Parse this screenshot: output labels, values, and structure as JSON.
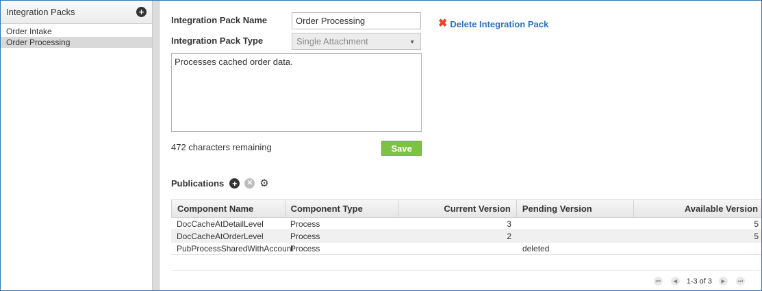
{
  "sidebar": {
    "title": "Integration Packs",
    "add_icon": "plus-circle-icon",
    "items": [
      {
        "label": "Order Intake",
        "selected": false
      },
      {
        "label": "Order Processing",
        "selected": true
      }
    ]
  },
  "form": {
    "name_label": "Integration Pack Name",
    "name_value": "Order Processing",
    "type_label": "Integration Pack Type",
    "type_value": "Single Attachment",
    "description": "Processes cached order data.",
    "remaining": "472 characters remaining",
    "save_label": "Save",
    "delete_label": "Delete Integration Pack"
  },
  "publications": {
    "title": "Publications",
    "columns": [
      "Component Name",
      "Component Type",
      "Current Version",
      "Pending Version",
      "Available Version"
    ],
    "rows": [
      [
        "DocCacheAtDetailLevel",
        "Process",
        "3",
        "",
        "5"
      ],
      [
        "DocCacheAtOrderLevel",
        "Process",
        "2",
        "",
        "5"
      ],
      [
        "PubProcessSharedWithAccount",
        "Process",
        "",
        "deleted",
        ""
      ]
    ],
    "pager_text": "1-3 of 3"
  },
  "colors": {
    "accent_link": "#2a73b8",
    "save_green": "#7dc242",
    "delete_red": "#e2452a"
  }
}
